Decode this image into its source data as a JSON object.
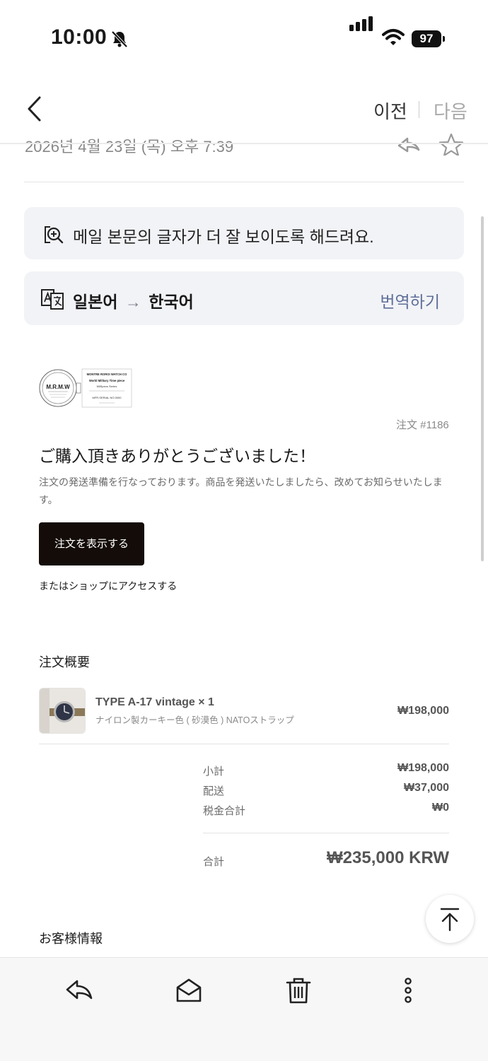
{
  "status_bar": {
    "time": "10:00",
    "battery": "97",
    "icons": [
      "bell-slash-icon",
      "signal-icon",
      "wifi-icon",
      "battery-icon"
    ]
  },
  "nav": {
    "prev_label": "이전",
    "next_label": "다음",
    "back_icon": "chevron-left-icon"
  },
  "header": {
    "date": "2026년 4월 23일 (목) 오후 7:39",
    "icons": [
      "reply-icon",
      "star-icon"
    ]
  },
  "readability_banner": {
    "icon": "zoom-in-icon",
    "text": "메일 본문의 글자가 더 잘 보이도록 해드려요."
  },
  "translate_banner": {
    "icon": "translate-icon",
    "from": "일본어",
    "arrow": "→",
    "to": "한국어",
    "action": "번역하기"
  },
  "email": {
    "logo": {
      "brand": "M.R.M.W",
      "lines": [
        "MONTRE ROROI WATCH CO",
        "World Military Time piece",
        "MilSpecs Series",
        "MFR.SERIAL NO.0000"
      ]
    },
    "order_number": "注文 #1186",
    "heading": "ご購入頂きありがとうございました！",
    "message": "注文の発送準備を行なっております。商品を発送いたしましたら、改めてお知らせいたします。",
    "view_order_button": "注文を表示する",
    "shop_link": "またはショップにアクセスする",
    "summary_title": "注文概要",
    "item": {
      "name": "TYPE A-17 vintage × 1",
      "variant": "ナイロン製カーキー色 ( 砂漠色 ) NATOストラップ",
      "price": "₩198,000"
    },
    "totals": [
      {
        "label": "小計",
        "value": "₩198,000"
      },
      {
        "label": "配送",
        "value": "₩37,000"
      },
      {
        "label": "税金合計",
        "value": "₩0"
      }
    ],
    "grand_total": {
      "label": "合計",
      "value": "₩235,000 KRW"
    },
    "customer_title": "お客様情報"
  },
  "scroll_top_icon": "arrow-up-to-line-icon",
  "toolbar": {
    "icons": [
      "reply-icon",
      "mark-read-icon",
      "trash-icon",
      "more-vertical-icon"
    ]
  },
  "colors": {
    "accent": "#5f6f98",
    "button_bg": "#140c08",
    "card_bg": "#f2f3f7"
  }
}
